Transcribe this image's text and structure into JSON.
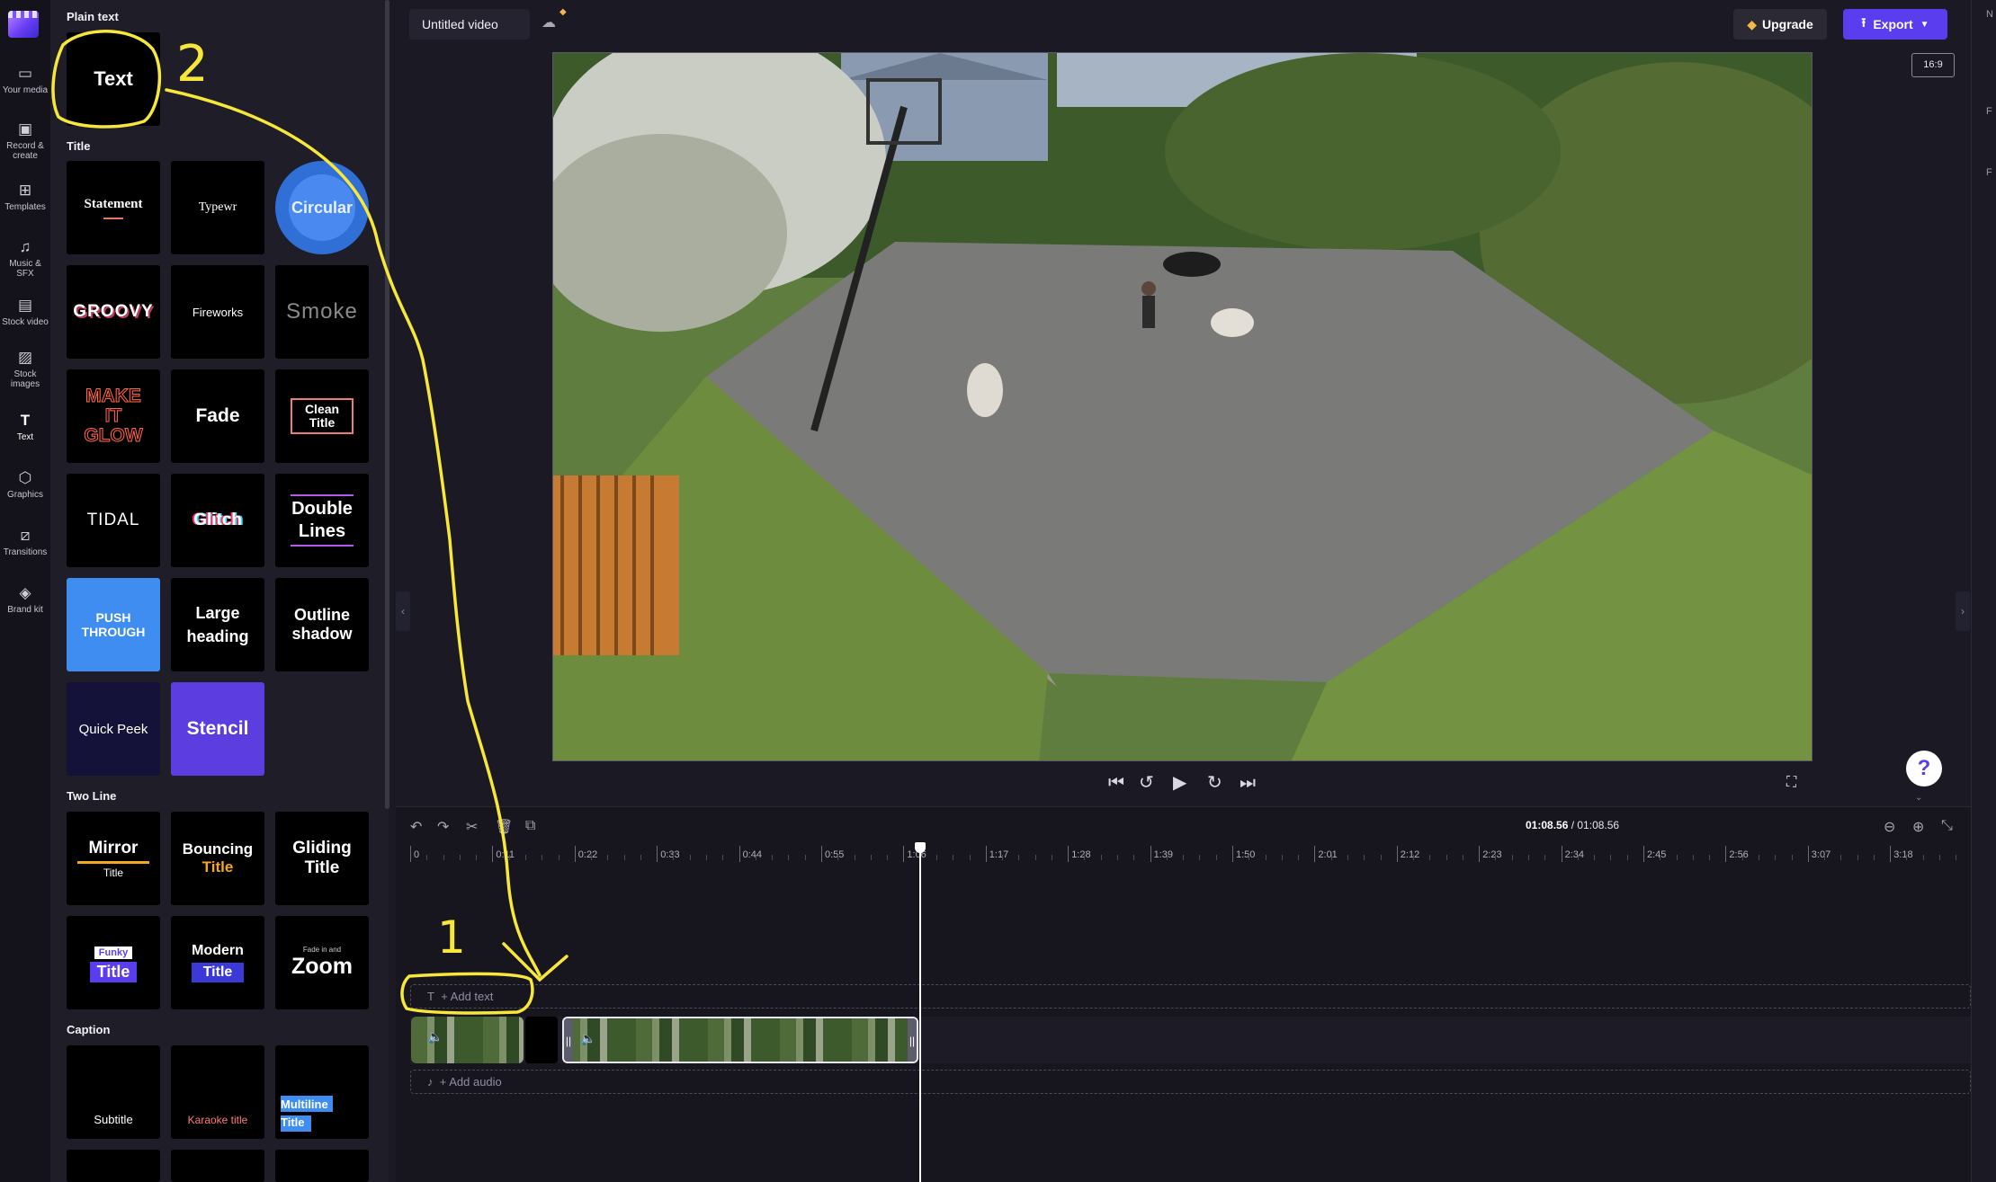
{
  "rail": [
    {
      "label": "Your media",
      "icon": "folder-icon"
    },
    {
      "label": "Record & create",
      "icon": "camera-icon"
    },
    {
      "label": "Templates",
      "icon": "templates-icon"
    },
    {
      "label": "Music & SFX",
      "icon": "music-icon"
    },
    {
      "label": "Stock video",
      "icon": "film-icon"
    },
    {
      "label": "Stock images",
      "icon": "image-icon"
    },
    {
      "label": "Text",
      "icon": "text-icon"
    },
    {
      "label": "Graphics",
      "icon": "shapes-icon"
    },
    {
      "label": "Transitions",
      "icon": "transitions-icon"
    },
    {
      "label": "Brand kit",
      "icon": "brand-icon"
    }
  ],
  "panel": {
    "plain_text": "Plain text",
    "plain_tile": "Text",
    "title_section": "Title",
    "title_tiles": [
      "Statement",
      "Typewr",
      "Circular",
      "GROOVY",
      "Fireworks",
      "Smoke",
      "MAKE IT GLOW",
      "Fade",
      "Clean Title",
      "TIDAL",
      "Glitch",
      "Double Lines",
      "PUSH THROUGH",
      "Large heading",
      "Outline shadow",
      "Quick Peek",
      "Stencil"
    ],
    "two_line_section": "Two Line",
    "two_line_tiles": [
      {
        "a": "Mirror",
        "b": "Title"
      },
      {
        "a": "Bouncing",
        "b": "Title"
      },
      {
        "a": "Gliding",
        "b": "Title"
      },
      {
        "a": "Funky",
        "b": "Title"
      },
      {
        "a": "Modern",
        "b": "Title"
      },
      {
        "a": "Fade in and",
        "b": "Zoom"
      }
    ],
    "caption_section": "Caption",
    "caption_tiles": [
      "Subtitle",
      "Karaoke title",
      "Multiline Title"
    ]
  },
  "topbar": {
    "title": "Untitled video",
    "upgrade": "Upgrade",
    "export": "Export",
    "aspect": "16:9"
  },
  "timeline": {
    "current": "01:08.56",
    "total": "/ 01:08.56",
    "ticks": [
      "0",
      "0:11",
      "0:22",
      "0:33",
      "0:44",
      "0:55",
      "1:06",
      "1:17",
      "1:28",
      "1:39",
      "1:50",
      "2:01",
      "2:12",
      "2:23",
      "2:34",
      "2:45",
      "2:56",
      "3:07",
      "3:18"
    ],
    "add_text": "+ Add text",
    "add_audio": "+ Add audio"
  },
  "annotations": [
    "2",
    "1"
  ],
  "colors": {
    "accent": "#5b3df0",
    "annotation": "#f6e73a"
  }
}
